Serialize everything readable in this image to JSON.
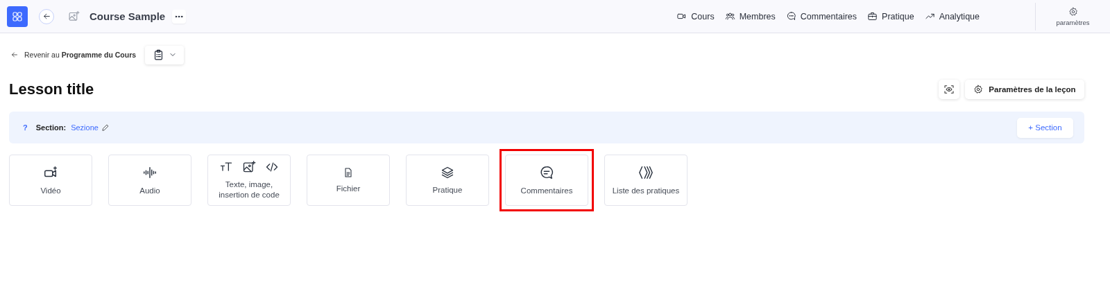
{
  "topbar": {
    "course_title": "Course Sample",
    "nav": [
      {
        "label": "Cours"
      },
      {
        "label": "Membres"
      },
      {
        "label": "Commentaires"
      },
      {
        "label": "Pratique"
      },
      {
        "label": "Analytique"
      }
    ],
    "settings_label": "paramètres"
  },
  "breadcrumb": {
    "prefix": "Revenir au",
    "target": "Programme du Cours"
  },
  "lesson": {
    "title": "Lesson title",
    "settings_button": "Paramètres de la leçon"
  },
  "section": {
    "help": "?",
    "label": "Section:",
    "value": "Sezione",
    "add_button": "+ Section"
  },
  "blocks": [
    {
      "label": "Vidéo",
      "kind": "video",
      "highlighted": false
    },
    {
      "label": "Audio",
      "kind": "audio",
      "highlighted": false
    },
    {
      "label": "Texte, image, insertion de code",
      "kind": "rich",
      "highlighted": false
    },
    {
      "label": "Fichier",
      "kind": "file",
      "highlighted": false
    },
    {
      "label": "Pratique",
      "kind": "layers",
      "highlighted": false
    },
    {
      "label": "Commentaires",
      "kind": "comment",
      "highlighted": true
    },
    {
      "label": "Liste des pratiques",
      "kind": "list",
      "highlighted": false
    }
  ]
}
